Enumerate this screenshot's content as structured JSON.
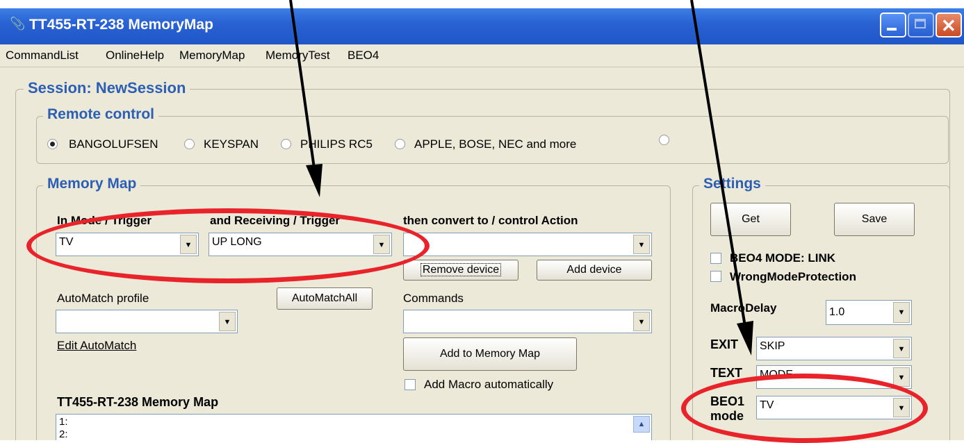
{
  "window": {
    "title": "TT455-RT-238 MemoryMap"
  },
  "menu": {
    "items": [
      "CommandList",
      "OnlineHelp",
      "MemoryMap",
      "MemoryTest",
      "BEO4"
    ]
  },
  "session": {
    "legend": "Session: NewSession"
  },
  "remote_control": {
    "legend": "Remote control",
    "options": [
      "BANGOLUFSEN",
      "KEYSPAN",
      "PHILIPS RC5",
      "APPLE, BOSE, NEC and more"
    ],
    "selected": "BANGOLUFSEN"
  },
  "memory_map": {
    "legend": "Memory Map",
    "mode_trigger_label": "In Mode / Trigger",
    "mode_trigger_value": "TV",
    "receiving_label": "and Receiving / Trigger",
    "receiving_value": "UP LONG",
    "convert_label": "then convert to / control Action",
    "convert_value": "",
    "remove_device": "Remove device",
    "add_device": "Add device",
    "automatch_profile_label": "AutoMatch profile",
    "automatch_all": "AutoMatchAll",
    "automatch_value": "",
    "edit_automatch": "Edit AutoMatch",
    "commands_label": "Commands",
    "commands_value": "",
    "add_to_memory_map": "Add to Memory Map",
    "add_macro_auto": "Add Macro automatically",
    "list_title": "TT455-RT-238 Memory Map",
    "list_lines": [
      "1:",
      "2:"
    ]
  },
  "settings": {
    "legend": "Settings",
    "get": "Get",
    "save": "Save",
    "beo4_mode_link": "BEO4 MODE: LINK",
    "wrong_mode_protection": "WrongModeProtection",
    "macro_delay_label": "MacroDelay",
    "macro_delay_value": "1.0",
    "exit_label": "EXIT",
    "exit_value": "SKIP",
    "text_label": "TEXT",
    "text_value": "MODE",
    "beo1_label_1": "BEO1",
    "beo1_label_2": "mode",
    "beo1_value": "TV"
  },
  "colors": {
    "titlebar": "#2a62d3",
    "legend_text": "#2c5fb4",
    "annotation_ring": "#e8232a",
    "annotation_arrow": "#000000"
  }
}
